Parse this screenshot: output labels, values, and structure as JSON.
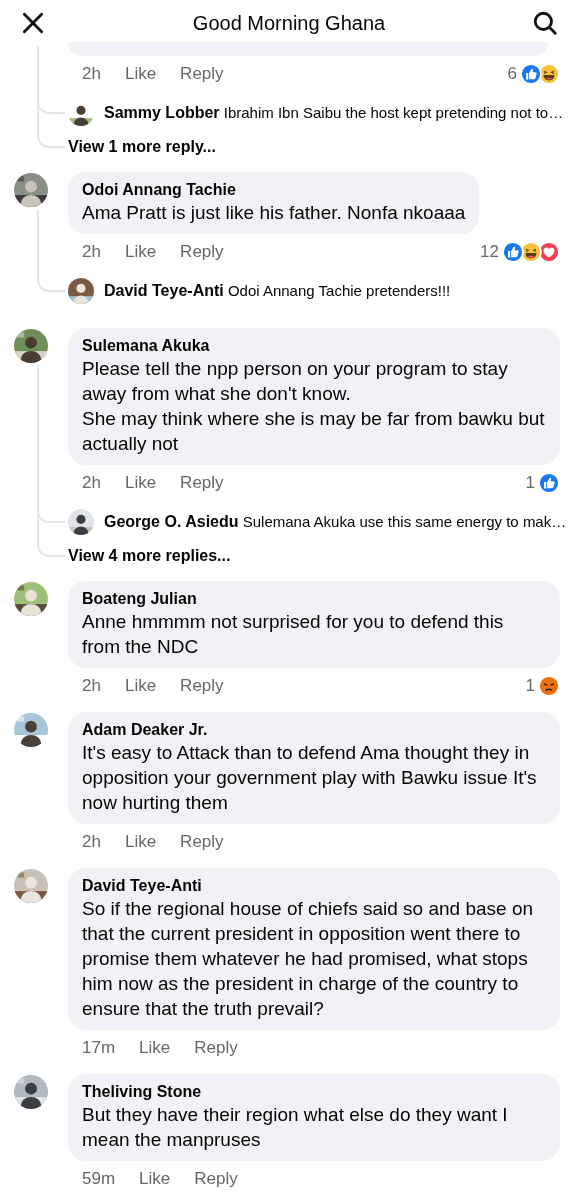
{
  "header": {
    "title": "Good Morning Ghana"
  },
  "comments": [
    {
      "time": "2h",
      "like": "Like",
      "reply": "Reply",
      "reaction_count": "6",
      "reactions": [
        {
          "kind": "like"
        },
        {
          "kind": "haha"
        }
      ],
      "replies": [
        {
          "author": "Sammy Lobber",
          "text": "Ibrahim Ibn Saibu the host kept pretending not to…"
        }
      ],
      "more_replies": "View 1 more reply..."
    },
    {
      "author": "Odoi Annang Tachie",
      "text": "Ama Pratt is just like his father. Nonfa nkoaaa",
      "time": "2h",
      "like": "Like",
      "reply": "Reply",
      "reaction_count": "12",
      "reactions": [
        {
          "kind": "like"
        },
        {
          "kind": "haha"
        },
        {
          "kind": "love"
        }
      ],
      "replies": [
        {
          "author": "David Teye-Anti",
          "text": "Odoi Annang Tachie pretenders!!!"
        }
      ]
    },
    {
      "author": "Sulemana Akuka",
      "text": "Please tell the npp person on your program to stay away from what she don't know.\nShe may think where she is may be far from bawku but actually not",
      "time": "2h",
      "like": "Like",
      "reply": "Reply",
      "reaction_count": "1",
      "reactions": [
        {
          "kind": "like"
        }
      ],
      "replies": [
        {
          "author": "George O. Asiedu",
          "text": "Sulemana Akuka use this same energy to mak…"
        }
      ],
      "more_replies": "View 4 more replies..."
    },
    {
      "author": "Boateng Julian",
      "text": "Anne hmmmm not surprised for you to defend this from the NDC",
      "time": "2h",
      "like": "Like",
      "reply": "Reply",
      "reaction_count": "1",
      "reactions": [
        {
          "kind": "angry"
        }
      ]
    },
    {
      "author": "Adam Deaker Jr.",
      "text": "It's easy to Attack than to defend Ama thought they in opposition your government play with Bawku issue It's now hurting them",
      "time": "2h",
      "like": "Like",
      "reply": "Reply"
    },
    {
      "author": "David Teye-Anti",
      "text": "So if the regional house of chiefs said so and base on that the current president in opposition went there to promise them whatever he had promised, what stops him now as the president in charge of the country to ensure that the truth prevail?",
      "time": "17m",
      "like": "Like",
      "reply": "Reply"
    },
    {
      "author": "Theliving Stone",
      "text": "But they have their region what else do they want I mean the manpruses",
      "time": "59m",
      "like": "Like",
      "reply": "Reply"
    }
  ]
}
